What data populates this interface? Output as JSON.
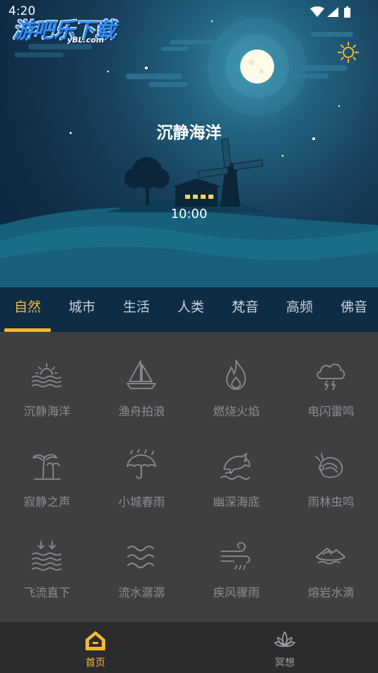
{
  "status_bar": {
    "time": "4:20"
  },
  "watermark": {
    "text": "游吧乐下载",
    "subtext": "yBL.com"
  },
  "hero": {
    "title": "沉静海洋",
    "timer": "10:00"
  },
  "colors": {
    "accent": "#f5b831",
    "tab_bar": "#0e2d45",
    "grid_bg": "#3e3f41",
    "nav_bg": "#2b2c2e"
  },
  "tabs": [
    {
      "label": "自然",
      "active": true
    },
    {
      "label": "城市",
      "active": false
    },
    {
      "label": "生活",
      "active": false
    },
    {
      "label": "人类",
      "active": false
    },
    {
      "label": "梵音",
      "active": false
    },
    {
      "label": "高频",
      "active": false
    },
    {
      "label": "佛音",
      "active": false
    }
  ],
  "sounds": [
    {
      "label": "沉静海洋",
      "icon": "sunrise-sea-icon"
    },
    {
      "label": "渔舟拍浪",
      "icon": "sailboat-icon"
    },
    {
      "label": "燃烧火焰",
      "icon": "flame-icon"
    },
    {
      "label": "电闪雷鸣",
      "icon": "thunder-cloud-icon"
    },
    {
      "label": "寂静之声",
      "icon": "palm-tree-icon"
    },
    {
      "label": "小城春雨",
      "icon": "umbrella-rain-icon"
    },
    {
      "label": "幽深海底",
      "icon": "dolphin-icon"
    },
    {
      "label": "雨林虫鸣",
      "icon": "insect-icon"
    },
    {
      "label": "飞流直下",
      "icon": "waterfall-icon"
    },
    {
      "label": "流水潺潺",
      "icon": "flowing-water-icon"
    },
    {
      "label": "疾风骤雨",
      "icon": "wind-rain-icon"
    },
    {
      "label": "熔岩水滴",
      "icon": "lava-drop-icon"
    }
  ],
  "bottom_nav": {
    "home_label": "首页",
    "meditate_label": "冥想"
  }
}
